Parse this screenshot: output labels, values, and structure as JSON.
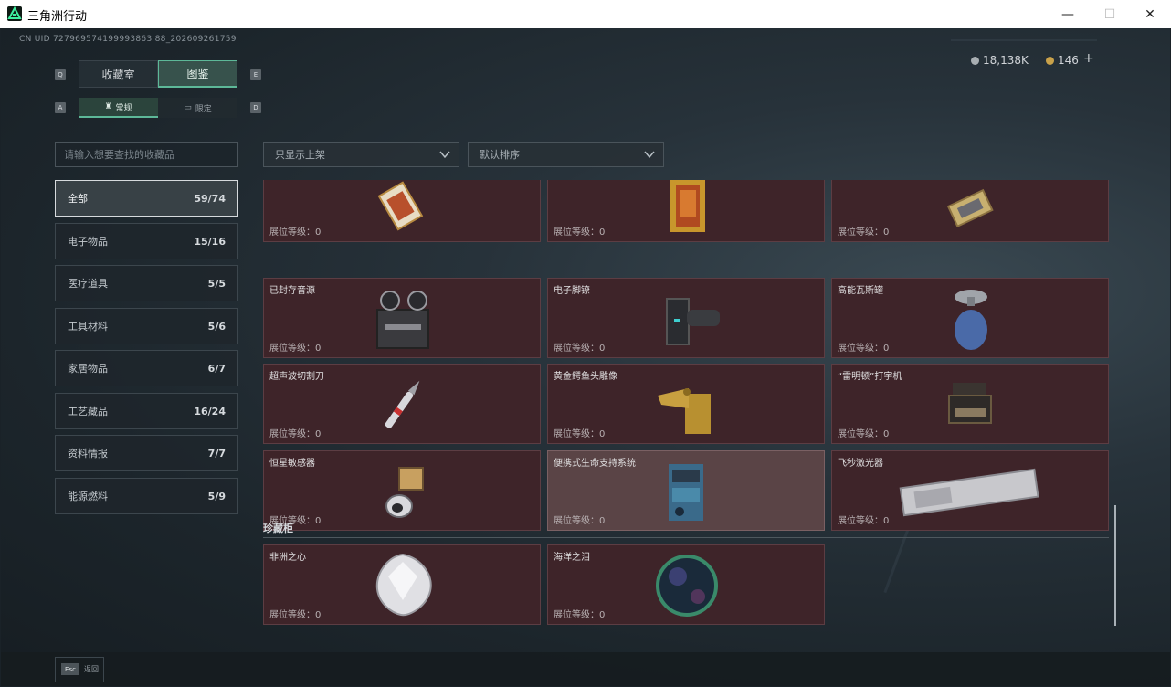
{
  "window": {
    "title": "三角洲行动",
    "minimize": "—",
    "maximize": "☐",
    "close": "✕"
  },
  "header": {
    "uid": "CN UID 727969574199993863 88_202609261759",
    "currency_silver": "18,138K",
    "currency_gold": "146",
    "add": "+"
  },
  "tabs": {
    "key_left": "Q",
    "key_right": "E",
    "items": [
      {
        "label": "收藏室"
      },
      {
        "label": "图鉴"
      }
    ],
    "active": "图鉴"
  },
  "subtabs": {
    "key_left": "A",
    "key_right": "D",
    "items": [
      {
        "label": "常规"
      },
      {
        "label": "限定"
      }
    ]
  },
  "search": {
    "placeholder": "请输入想要查找的收藏品"
  },
  "filters": {
    "shelf": "只显示上架",
    "sort": "默认排序"
  },
  "categories": [
    {
      "label": "全部",
      "count": "59/74"
    },
    {
      "label": "电子物品",
      "count": "15/16"
    },
    {
      "label": "医疗道具",
      "count": "5/5"
    },
    {
      "label": "工具材料",
      "count": "5/6"
    },
    {
      "label": "家居物品",
      "count": "6/7"
    },
    {
      "label": "工艺藏品",
      "count": "16/24"
    },
    {
      "label": "资料情报",
      "count": "7/7"
    },
    {
      "label": "能源燃料",
      "count": "5/9"
    }
  ],
  "level_label": "展位等级：",
  "items": [
    {
      "name": "",
      "level": "0",
      "icon": "ornate-card-icon"
    },
    {
      "name": "",
      "level": "0",
      "icon": "painting-icon"
    },
    {
      "name": "",
      "level": "0",
      "icon": "gold-device-icon"
    },
    {
      "name": "已封存音源",
      "level": "0",
      "icon": "reel-recorder-icon"
    },
    {
      "name": "电子脚镣",
      "level": "0",
      "icon": "ankle-monitor-icon"
    },
    {
      "name": "高能瓦斯罐",
      "level": "0",
      "icon": "gas-canister-icon"
    },
    {
      "name": "超声波切割刀",
      "level": "0",
      "icon": "ultrasonic-knife-icon"
    },
    {
      "name": "黄金鳄鱼头雕像",
      "level": "0",
      "icon": "gold-crocodile-icon"
    },
    {
      "name": "“雷明顿”打字机",
      "level": "0",
      "icon": "typewriter-icon"
    },
    {
      "name": "恒星敏感器",
      "level": "0",
      "icon": "star-sensor-icon"
    },
    {
      "name": "便携式生命支持系统",
      "level": "0",
      "icon": "life-support-icon"
    },
    {
      "name": "飞秒激光器",
      "level": "0",
      "icon": "laser-icon"
    }
  ],
  "treasure": {
    "title": "珍藏柜",
    "items": [
      {
        "name": "非洲之心",
        "level": "0",
        "icon": "diamond-icon"
      },
      {
        "name": "海洋之泪",
        "level": "0",
        "icon": "pearl-icon"
      }
    ]
  },
  "footer": {
    "esc_key": "Esc",
    "esc_label": "返回"
  },
  "colors": {
    "accent": "#5db898",
    "card_bg": "#3e2429",
    "card_highlight": "#5a4446"
  }
}
